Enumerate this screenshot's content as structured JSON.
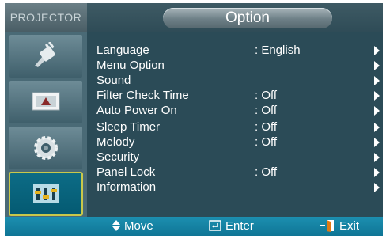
{
  "brand": "PROJECTOR",
  "title": "Option",
  "sidebar": {
    "items": [
      {
        "icon": "input-plug-icon"
      },
      {
        "icon": "picture-icon"
      },
      {
        "icon": "setup-gear-icon"
      },
      {
        "icon": "option-icon",
        "active": true
      }
    ]
  },
  "menu": {
    "items": [
      {
        "label": "Language",
        "value": ": English"
      },
      {
        "label": "Menu Option",
        "value": ""
      },
      {
        "label": "Sound",
        "value": ""
      },
      {
        "label": "Filter Check Time",
        "value": ": Off"
      },
      {
        "label": "Auto Power On",
        "value": ": Off"
      },
      {
        "label": "Sleep Timer",
        "value": ": Off"
      },
      {
        "label": "Melody",
        "value": ": Off"
      },
      {
        "label": "Security",
        "value": ""
      },
      {
        "label": "Panel Lock",
        "value": ": Off"
      },
      {
        "label": "Information",
        "value": ""
      }
    ]
  },
  "footer": {
    "move_label": "Move",
    "enter_label": "Enter",
    "exit_label": "Exit"
  },
  "colors": {
    "background": "#2b4b57",
    "footer": "#1c8fb0",
    "active_outline": "#c9c84a",
    "text": "#ffffff"
  }
}
